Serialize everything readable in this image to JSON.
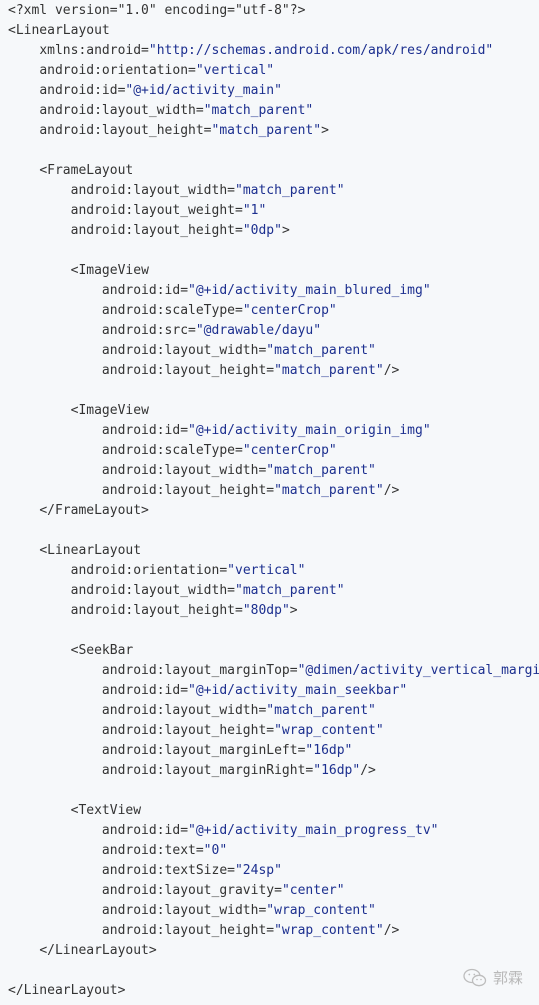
{
  "code": {
    "lines": [
      {
        "indent": 0,
        "parts": [
          {
            "t": "pi",
            "v": "<?xml version=\"1.0\" encoding=\"utf-8\"?>"
          }
        ]
      },
      {
        "indent": 0,
        "parts": [
          {
            "t": "tag",
            "v": "<LinearLayout"
          }
        ]
      },
      {
        "indent": 4,
        "parts": [
          {
            "t": "attr",
            "v": "xmlns:android="
          },
          {
            "t": "str",
            "v": "\"http://schemas.android.com/apk/res/android\""
          }
        ]
      },
      {
        "indent": 4,
        "parts": [
          {
            "t": "attr",
            "v": "android:orientation="
          },
          {
            "t": "str",
            "v": "\"vertical\""
          }
        ]
      },
      {
        "indent": 4,
        "parts": [
          {
            "t": "attr",
            "v": "android:id="
          },
          {
            "t": "str",
            "v": "\"@+id/activity_main\""
          }
        ]
      },
      {
        "indent": 4,
        "parts": [
          {
            "t": "attr",
            "v": "android:layout_width="
          },
          {
            "t": "str",
            "v": "\"match_parent\""
          }
        ]
      },
      {
        "indent": 4,
        "parts": [
          {
            "t": "attr",
            "v": "android:layout_height="
          },
          {
            "t": "str",
            "v": "\"match_parent\""
          },
          {
            "t": "tag",
            "v": ">"
          }
        ]
      },
      {
        "indent": 0,
        "parts": []
      },
      {
        "indent": 4,
        "parts": [
          {
            "t": "tag",
            "v": "<FrameLayout"
          }
        ]
      },
      {
        "indent": 8,
        "parts": [
          {
            "t": "attr",
            "v": "android:layout_width="
          },
          {
            "t": "str",
            "v": "\"match_parent\""
          }
        ]
      },
      {
        "indent": 8,
        "parts": [
          {
            "t": "attr",
            "v": "android:layout_weight="
          },
          {
            "t": "str",
            "v": "\"1\""
          }
        ]
      },
      {
        "indent": 8,
        "parts": [
          {
            "t": "attr",
            "v": "android:layout_height="
          },
          {
            "t": "str",
            "v": "\"0dp\""
          },
          {
            "t": "tag",
            "v": ">"
          }
        ]
      },
      {
        "indent": 0,
        "parts": []
      },
      {
        "indent": 8,
        "parts": [
          {
            "t": "tag",
            "v": "<ImageView"
          }
        ]
      },
      {
        "indent": 12,
        "parts": [
          {
            "t": "attr",
            "v": "android:id="
          },
          {
            "t": "str",
            "v": "\"@+id/activity_main_blured_img\""
          }
        ]
      },
      {
        "indent": 12,
        "parts": [
          {
            "t": "attr",
            "v": "android:scaleType="
          },
          {
            "t": "str",
            "v": "\"centerCrop\""
          }
        ]
      },
      {
        "indent": 12,
        "parts": [
          {
            "t": "attr",
            "v": "android:src="
          },
          {
            "t": "str",
            "v": "\"@drawable/dayu\""
          }
        ]
      },
      {
        "indent": 12,
        "parts": [
          {
            "t": "attr",
            "v": "android:layout_width="
          },
          {
            "t": "str",
            "v": "\"match_parent\""
          }
        ]
      },
      {
        "indent": 12,
        "parts": [
          {
            "t": "attr",
            "v": "android:layout_height="
          },
          {
            "t": "str",
            "v": "\"match_parent\""
          },
          {
            "t": "tag",
            "v": "/>"
          }
        ]
      },
      {
        "indent": 0,
        "parts": []
      },
      {
        "indent": 8,
        "parts": [
          {
            "t": "tag",
            "v": "<ImageView"
          }
        ]
      },
      {
        "indent": 12,
        "parts": [
          {
            "t": "attr",
            "v": "android:id="
          },
          {
            "t": "str",
            "v": "\"@+id/activity_main_origin_img\""
          }
        ]
      },
      {
        "indent": 12,
        "parts": [
          {
            "t": "attr",
            "v": "android:scaleType="
          },
          {
            "t": "str",
            "v": "\"centerCrop\""
          }
        ]
      },
      {
        "indent": 12,
        "parts": [
          {
            "t": "attr",
            "v": "android:layout_width="
          },
          {
            "t": "str",
            "v": "\"match_parent\""
          }
        ]
      },
      {
        "indent": 12,
        "parts": [
          {
            "t": "attr",
            "v": "android:layout_height="
          },
          {
            "t": "str",
            "v": "\"match_parent\""
          },
          {
            "t": "tag",
            "v": "/>"
          }
        ]
      },
      {
        "indent": 4,
        "parts": [
          {
            "t": "tag",
            "v": "</FrameLayout>"
          }
        ]
      },
      {
        "indent": 0,
        "parts": []
      },
      {
        "indent": 4,
        "parts": [
          {
            "t": "tag",
            "v": "<LinearLayout"
          }
        ]
      },
      {
        "indent": 8,
        "parts": [
          {
            "t": "attr",
            "v": "android:orientation="
          },
          {
            "t": "str",
            "v": "\"vertical\""
          }
        ]
      },
      {
        "indent": 8,
        "parts": [
          {
            "t": "attr",
            "v": "android:layout_width="
          },
          {
            "t": "str",
            "v": "\"match_parent\""
          }
        ]
      },
      {
        "indent": 8,
        "parts": [
          {
            "t": "attr",
            "v": "android:layout_height="
          },
          {
            "t": "str",
            "v": "\"80dp\""
          },
          {
            "t": "tag",
            "v": ">"
          }
        ]
      },
      {
        "indent": 0,
        "parts": []
      },
      {
        "indent": 8,
        "parts": [
          {
            "t": "tag",
            "v": "<SeekBar"
          }
        ]
      },
      {
        "indent": 12,
        "parts": [
          {
            "t": "attr",
            "v": "android:layout_marginTop="
          },
          {
            "t": "str",
            "v": "\"@dimen/activity_vertical_margin\""
          }
        ]
      },
      {
        "indent": 12,
        "parts": [
          {
            "t": "attr",
            "v": "android:id="
          },
          {
            "t": "str",
            "v": "\"@+id/activity_main_seekbar\""
          }
        ]
      },
      {
        "indent": 12,
        "parts": [
          {
            "t": "attr",
            "v": "android:layout_width="
          },
          {
            "t": "str",
            "v": "\"match_parent\""
          }
        ]
      },
      {
        "indent": 12,
        "parts": [
          {
            "t": "attr",
            "v": "android:layout_height="
          },
          {
            "t": "str",
            "v": "\"wrap_content\""
          }
        ]
      },
      {
        "indent": 12,
        "parts": [
          {
            "t": "attr",
            "v": "android:layout_marginLeft="
          },
          {
            "t": "str",
            "v": "\"16dp\""
          }
        ]
      },
      {
        "indent": 12,
        "parts": [
          {
            "t": "attr",
            "v": "android:layout_marginRight="
          },
          {
            "t": "str",
            "v": "\"16dp\""
          },
          {
            "t": "tag",
            "v": "/>"
          }
        ]
      },
      {
        "indent": 0,
        "parts": []
      },
      {
        "indent": 8,
        "parts": [
          {
            "t": "tag",
            "v": "<TextView"
          }
        ]
      },
      {
        "indent": 12,
        "parts": [
          {
            "t": "attr",
            "v": "android:id="
          },
          {
            "t": "str",
            "v": "\"@+id/activity_main_progress_tv\""
          }
        ]
      },
      {
        "indent": 12,
        "parts": [
          {
            "t": "attr",
            "v": "android:text="
          },
          {
            "t": "str",
            "v": "\"0\""
          }
        ]
      },
      {
        "indent": 12,
        "parts": [
          {
            "t": "attr",
            "v": "android:textSize="
          },
          {
            "t": "str",
            "v": "\"24sp\""
          }
        ]
      },
      {
        "indent": 12,
        "parts": [
          {
            "t": "attr",
            "v": "android:layout_gravity="
          },
          {
            "t": "str",
            "v": "\"center\""
          }
        ]
      },
      {
        "indent": 12,
        "parts": [
          {
            "t": "attr",
            "v": "android:layout_width="
          },
          {
            "t": "str",
            "v": "\"wrap_content\""
          }
        ]
      },
      {
        "indent": 12,
        "parts": [
          {
            "t": "attr",
            "v": "android:layout_height="
          },
          {
            "t": "str",
            "v": "\"wrap_content\""
          },
          {
            "t": "tag",
            "v": "/>"
          }
        ]
      },
      {
        "indent": 4,
        "parts": [
          {
            "t": "tag",
            "v": "</LinearLayout>"
          }
        ]
      },
      {
        "indent": 0,
        "parts": []
      },
      {
        "indent": 0,
        "parts": [
          {
            "t": "tag",
            "v": "</LinearLayout>"
          }
        ]
      }
    ]
  },
  "watermark": {
    "icon": "wechat-icon",
    "author": "郭霖"
  },
  "colors": {
    "background": "#f6f8fa",
    "text": "#333333",
    "string": "#1c2f8f",
    "watermark": "#b9b9b9"
  }
}
